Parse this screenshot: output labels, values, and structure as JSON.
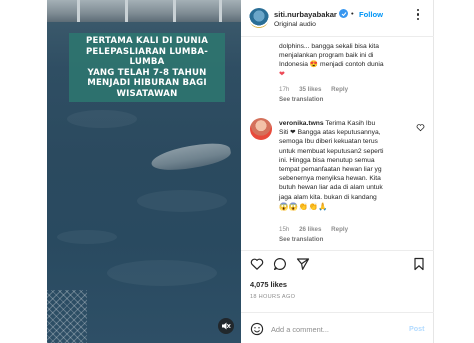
{
  "video": {
    "caption_lines": [
      "PERTAMA KALI DI DUNIA",
      "PELEPASLIARAN LUMBA-LUMBA",
      "YANG TELAH 7-8 TAHUN",
      "MENJADI HIBURAN BAGI",
      "WISATAWAN"
    ],
    "mute_icon": "speaker-muted-icon"
  },
  "header": {
    "username": "siti.nurbayabakar",
    "separator": "•",
    "follow_label": "Follow",
    "audio_label": "Original audio",
    "verified_icon": "verified-badge-icon",
    "more_icon": "more-options-icon"
  },
  "comments": [
    {
      "text_lines": [
        "dolphins... bangga sekali bisa kita",
        "menjalankan program baik ini di",
        "Indonesia 😍 menjadi contoh dunia"
      ],
      "trailing_emoji": "❤",
      "time": "17h",
      "likes": "35 likes",
      "reply": "Reply",
      "see_translation": "See translation"
    },
    {
      "username": "veronika.twns",
      "text_first": "Terima Kasih Ibu",
      "text_lines": [
        "Siti ❤ Bangga atas keputusannya,",
        "semoga Ibu diberi kekuatan terus",
        "untuk membuat keputusan2 seperti",
        "ini. Hingga bisa menutup semua",
        "tempat pemanfaatan hewan liar yg",
        "sebenernya menyiksa hewan. Kita",
        "butuh hewan liar ada di alam untuk",
        "jaga alam kita. bukan di kandang"
      ],
      "emojis": "😱😱👏👏🙏",
      "time": "15h",
      "likes": "26 likes",
      "reply": "Reply",
      "see_translation": "See translation"
    }
  ],
  "actions": {
    "like_icon": "heart-icon",
    "comment_icon": "comment-icon",
    "share_icon": "share-icon",
    "save_icon": "bookmark-icon",
    "likes_count": "4,075 likes",
    "time_ago": "18 HOURS AGO"
  },
  "add_comment": {
    "placeholder": "Add a comment...",
    "post_label": "Post",
    "emoji_icon": "emoji-icon"
  },
  "colors": {
    "accent": "#0095f6",
    "heart": "#ed4956",
    "caption_bg": "#2e7670",
    "post_disabled": "#b3dbff"
  }
}
